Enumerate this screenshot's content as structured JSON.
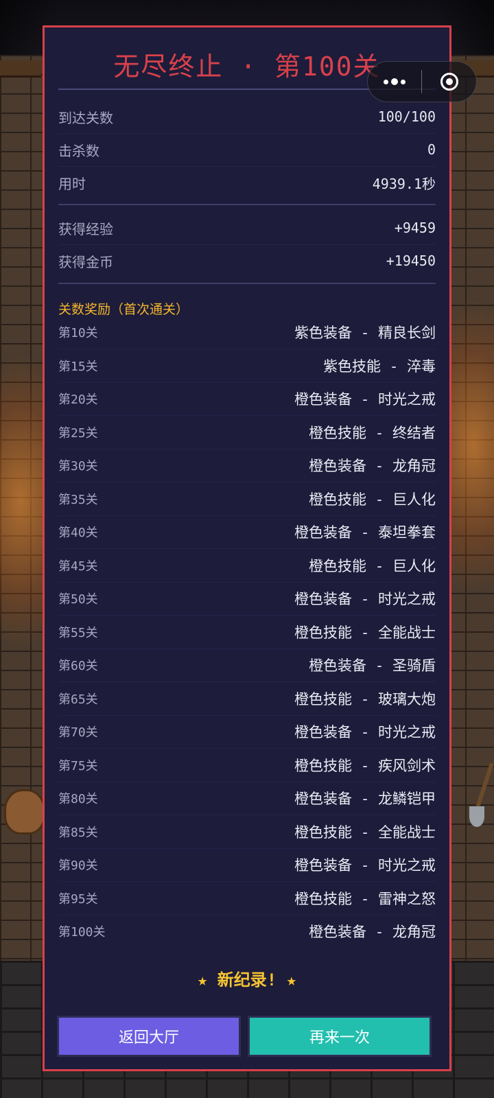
{
  "title": "无尽终止 · 第100关",
  "stats": [
    {
      "label": "到达关数",
      "value": "100/100"
    },
    {
      "label": "击杀数",
      "value": "0"
    },
    {
      "label": "用时",
      "value": "4939.1秒"
    }
  ],
  "earnings": [
    {
      "label": "获得经验",
      "value": "+9459"
    },
    {
      "label": "获得金币",
      "value": "+19450"
    }
  ],
  "rewards_title": "关数奖励（首次通关）",
  "rewards": [
    {
      "level": "第10关",
      "item": "紫色装备 - 精良长剑"
    },
    {
      "level": "第15关",
      "item": "紫色技能 - 淬毒"
    },
    {
      "level": "第20关",
      "item": "橙色装备 - 时光之戒"
    },
    {
      "level": "第25关",
      "item": "橙色技能 - 终结者"
    },
    {
      "level": "第30关",
      "item": "橙色装备 - 龙角冠"
    },
    {
      "level": "第35关",
      "item": "橙色技能 - 巨人化"
    },
    {
      "level": "第40关",
      "item": "橙色装备 - 泰坦拳套"
    },
    {
      "level": "第45关",
      "item": "橙色技能 - 巨人化"
    },
    {
      "level": "第50关",
      "item": "橙色装备 - 时光之戒"
    },
    {
      "level": "第55关",
      "item": "橙色技能 - 全能战士"
    },
    {
      "level": "第60关",
      "item": "橙色装备 - 圣骑盾"
    },
    {
      "level": "第65关",
      "item": "橙色技能 - 玻璃大炮"
    },
    {
      "level": "第70关",
      "item": "橙色装备 - 时光之戒"
    },
    {
      "level": "第75关",
      "item": "橙色技能 - 疾风剑术"
    },
    {
      "level": "第80关",
      "item": "橙色装备 - 龙鳞铠甲"
    },
    {
      "level": "第85关",
      "item": "橙色技能 - 全能战士"
    },
    {
      "level": "第90关",
      "item": "橙色装备 - 时光之戒"
    },
    {
      "level": "第95关",
      "item": "橙色技能 - 雷神之怒"
    },
    {
      "level": "第100关",
      "item": "橙色装备 - 龙角冠"
    }
  ],
  "new_record": "★ 新纪录! ★",
  "buttons": {
    "back": "返回大厅",
    "retry": "再来一次"
  },
  "capsule": {
    "more_icon": "more-dots-icon",
    "close_icon": "target-close-icon"
  },
  "colors": {
    "accent_red": "#d8414b",
    "gold": "#f4b62c",
    "panel_bg": "#1d1c3a",
    "btn_purple": "#6c5de2",
    "btn_teal": "#22bfae"
  }
}
